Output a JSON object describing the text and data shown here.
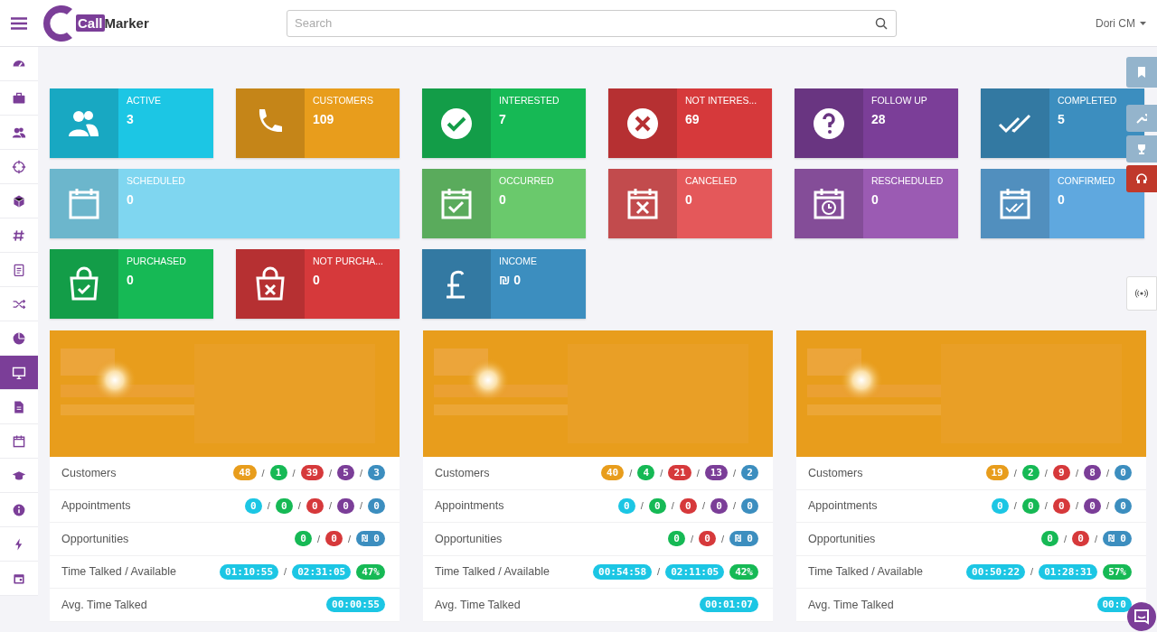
{
  "header": {
    "logo": "**Call**Marker",
    "search": {
      "placeholder": "Search"
    },
    "user": "Dori CM"
  },
  "sidebar": {
    "items": [
      {
        "selected": false
      },
      {
        "selected": false
      },
      {
        "selected": false
      },
      {
        "selected": false
      },
      {
        "selected": false
      },
      {
        "selected": false
      },
      {
        "selected": false
      },
      {
        "selected": false
      },
      {
        "selected": false
      },
      {
        "selected": true
      },
      {
        "selected": false
      },
      {
        "selected": false
      },
      {
        "selected": false
      },
      {
        "selected": false
      },
      {
        "selected": false
      },
      {
        "selected": false
      }
    ]
  },
  "tiles": [
    {
      "label": "ACTIVE",
      "value": "3",
      "kind": "normal",
      "color": "#1cc6e4"
    },
    {
      "label": "CUSTOMERS",
      "value": "109",
      "kind": "normal",
      "color": "#e89d1c"
    },
    {
      "label": "INTERESTED",
      "value": "7",
      "kind": "normal",
      "color": "#16b955"
    },
    {
      "label": "NOT INTERES...",
      "value": "69",
      "kind": "normal",
      "color": "#d6393b"
    },
    {
      "label": "FOLLOW UP",
      "value": "28",
      "kind": "normal",
      "color": "#7b3e98"
    },
    {
      "label": "COMPLETED",
      "value": "5",
      "kind": "normal",
      "color": "#3c8ebf"
    },
    {
      "label": "SCHEDULED",
      "value": "0",
      "kind": "wide",
      "color": "#7fd6f0"
    },
    {
      "label": "OCCURRED",
      "value": "0",
      "kind": "normal",
      "color": "#6ac96c"
    },
    {
      "label": "CANCELED",
      "value": "0",
      "kind": "normal",
      "color": "#e4585a"
    },
    {
      "label": "RESCHEDULED",
      "value": "0",
      "kind": "normal",
      "color": "#9b5bb3"
    },
    {
      "label": "CONFIRMED",
      "value": "0",
      "kind": "normal",
      "color": "#5fa8df"
    },
    {
      "label": "PURCHASED",
      "value": "0",
      "kind": "normal",
      "color": "#16b955"
    },
    {
      "label": "NOT PURCHA...",
      "value": "0",
      "kind": "normal",
      "color": "#d6393b"
    },
    {
      "label": "INCOME",
      "value": "₪ 0",
      "kind": "normal",
      "color": "#3c8ebf"
    }
  ],
  "cards": [
    {
      "kind": "picture",
      "rows": [
        {
          "label": "Customers",
          "values": [
            {
              "kind": "badge",
              "text": "48",
              "color": "#e89d1c"
            },
            {
              "kind": "sep",
              "text": "/"
            },
            {
              "kind": "badge",
              "text": "1",
              "color": "#16b955"
            },
            {
              "kind": "sep",
              "text": "/"
            },
            {
              "kind": "badge",
              "text": "39",
              "color": "#d6393b"
            },
            {
              "kind": "sep",
              "text": "/"
            },
            {
              "kind": "badge",
              "text": "5",
              "color": "#7b3e98"
            },
            {
              "kind": "sep",
              "text": "/"
            },
            {
              "kind": "badge",
              "text": "3",
              "color": "#3c8ebf"
            }
          ]
        },
        {
          "label": "Appointments",
          "values": [
            {
              "kind": "badge",
              "text": "0",
              "color": "#1cc6e4"
            },
            {
              "kind": "sep",
              "text": "/"
            },
            {
              "kind": "badge",
              "text": "0",
              "color": "#16b955"
            },
            {
              "kind": "sep",
              "text": "/"
            },
            {
              "kind": "badge",
              "text": "0",
              "color": "#d6393b"
            },
            {
              "kind": "sep",
              "text": "/"
            },
            {
              "kind": "badge",
              "text": "0",
              "color": "#7b3e98"
            },
            {
              "kind": "sep",
              "text": "/"
            },
            {
              "kind": "badge",
              "text": "0",
              "color": "#3c8ebf"
            }
          ]
        },
        {
          "label": "Opportunities",
          "values": [
            {
              "kind": "badge",
              "text": "0",
              "color": "#16b955"
            },
            {
              "kind": "sep",
              "text": "/"
            },
            {
              "kind": "badge",
              "text": "0",
              "color": "#d6393b"
            },
            {
              "kind": "sep",
              "text": "/"
            },
            {
              "kind": "badge",
              "text": "₪ 0",
              "color": "#3c8ebf"
            }
          ]
        },
        {
          "label": "Time Talked / Available",
          "values": [
            {
              "kind": "badge",
              "text": "01:10:55",
              "color": "#1cc6e4"
            },
            {
              "kind": "sep",
              "text": "/"
            },
            {
              "kind": "badge",
              "text": "02:31:05",
              "color": "#1cc6e4"
            },
            {
              "kind": "badge",
              "text": "47%",
              "color": "#16b955"
            }
          ]
        },
        {
          "label": "Avg. Time Talked",
          "values": [
            {
              "kind": "badge",
              "text": "00:00:55",
              "color": "#1cc6e4"
            }
          ]
        }
      ]
    },
    {
      "kind": "picture",
      "rows": [
        {
          "label": "Customers",
          "values": [
            {
              "kind": "badge",
              "text": "40",
              "color": "#e89d1c"
            },
            {
              "kind": "sep",
              "text": "/"
            },
            {
              "kind": "badge",
              "text": "4",
              "color": "#16b955"
            },
            {
              "kind": "sep",
              "text": "/"
            },
            {
              "kind": "badge",
              "text": "21",
              "color": "#d6393b"
            },
            {
              "kind": "sep",
              "text": "/"
            },
            {
              "kind": "badge",
              "text": "13",
              "color": "#7b3e98"
            },
            {
              "kind": "sep",
              "text": "/"
            },
            {
              "kind": "badge",
              "text": "2",
              "color": "#3c8ebf"
            }
          ]
        },
        {
          "label": "Appointments",
          "values": [
            {
              "kind": "badge",
              "text": "0",
              "color": "#1cc6e4"
            },
            {
              "kind": "sep",
              "text": "/"
            },
            {
              "kind": "badge",
              "text": "0",
              "color": "#16b955"
            },
            {
              "kind": "sep",
              "text": "/"
            },
            {
              "kind": "badge",
              "text": "0",
              "color": "#d6393b"
            },
            {
              "kind": "sep",
              "text": "/"
            },
            {
              "kind": "badge",
              "text": "0",
              "color": "#7b3e98"
            },
            {
              "kind": "sep",
              "text": "/"
            },
            {
              "kind": "badge",
              "text": "0",
              "color": "#3c8ebf"
            }
          ]
        },
        {
          "label": "Opportunities",
          "values": [
            {
              "kind": "badge",
              "text": "0",
              "color": "#16b955"
            },
            {
              "kind": "sep",
              "text": "/"
            },
            {
              "kind": "badge",
              "text": "0",
              "color": "#d6393b"
            },
            {
              "kind": "sep",
              "text": "/"
            },
            {
              "kind": "badge",
              "text": "₪ 0",
              "color": "#3c8ebf"
            }
          ]
        },
        {
          "label": "Time Talked / Available",
          "values": [
            {
              "kind": "badge",
              "text": "00:54:58",
              "color": "#1cc6e4"
            },
            {
              "kind": "sep",
              "text": "/"
            },
            {
              "kind": "badge",
              "text": "02:11:05",
              "color": "#1cc6e4"
            },
            {
              "kind": "badge",
              "text": "42%",
              "color": "#16b955"
            }
          ]
        },
        {
          "label": "Avg. Time Talked",
          "values": [
            {
              "kind": "badge",
              "text": "00:01:07",
              "color": "#1cc6e4"
            }
          ]
        }
      ]
    },
    {
      "kind": "picture",
      "rows": [
        {
          "label": "Customers",
          "values": [
            {
              "kind": "badge",
              "text": "19",
              "color": "#e89d1c"
            },
            {
              "kind": "sep",
              "text": "/"
            },
            {
              "kind": "badge",
              "text": "2",
              "color": "#16b955"
            },
            {
              "kind": "sep",
              "text": "/"
            },
            {
              "kind": "badge",
              "text": "9",
              "color": "#d6393b"
            },
            {
              "kind": "sep",
              "text": "/"
            },
            {
              "kind": "badge",
              "text": "8",
              "color": "#7b3e98"
            },
            {
              "kind": "sep",
              "text": "/"
            },
            {
              "kind": "badge",
              "text": "0",
              "color": "#3c8ebf"
            }
          ]
        },
        {
          "label": "Appointments",
          "values": [
            {
              "kind": "badge",
              "text": "0",
              "color": "#1cc6e4"
            },
            {
              "kind": "sep",
              "text": "/"
            },
            {
              "kind": "badge",
              "text": "0",
              "color": "#16b955"
            },
            {
              "kind": "sep",
              "text": "/"
            },
            {
              "kind": "badge",
              "text": "0",
              "color": "#d6393b"
            },
            {
              "kind": "sep",
              "text": "/"
            },
            {
              "kind": "badge",
              "text": "0",
              "color": "#7b3e98"
            },
            {
              "kind": "sep",
              "text": "/"
            },
            {
              "kind": "badge",
              "text": "0",
              "color": "#3c8ebf"
            }
          ]
        },
        {
          "label": "Opportunities",
          "values": [
            {
              "kind": "badge",
              "text": "0",
              "color": "#16b955"
            },
            {
              "kind": "sep",
              "text": "/"
            },
            {
              "kind": "badge",
              "text": "0",
              "color": "#d6393b"
            },
            {
              "kind": "sep",
              "text": "/"
            },
            {
              "kind": "badge",
              "text": "₪ 0",
              "color": "#3c8ebf"
            }
          ]
        },
        {
          "label": "Time Talked / Available",
          "values": [
            {
              "kind": "badge",
              "text": "00:50:22",
              "color": "#1cc6e4"
            },
            {
              "kind": "sep",
              "text": "/"
            },
            {
              "kind": "badge",
              "text": "01:28:31",
              "color": "#1cc6e4"
            },
            {
              "kind": "badge",
              "text": "57%",
              "color": "#16b955"
            }
          ]
        },
        {
          "label": "Avg. Time Talked",
          "values": [
            {
              "kind": "badge",
              "text": "00:0",
              "color": "#1cc6e4"
            }
          ]
        }
      ]
    }
  ]
}
